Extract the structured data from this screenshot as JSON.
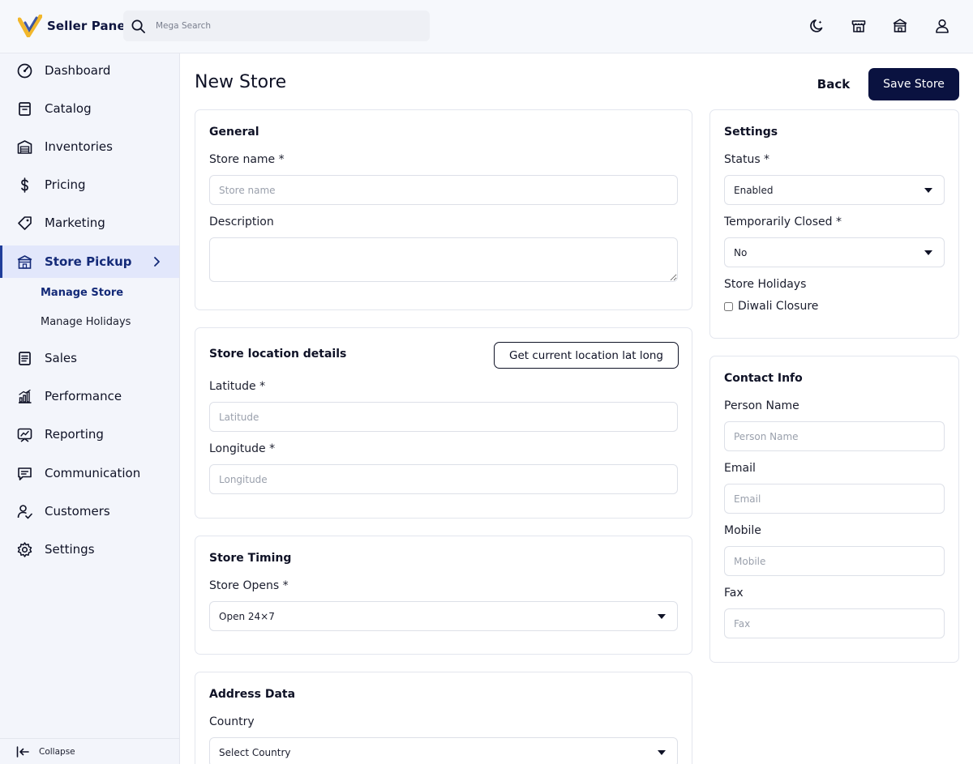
{
  "header": {
    "brand": "Seller Panel",
    "search_placeholder": "Mega Search",
    "icons": [
      "search-icon",
      "moon-icon",
      "storefront-icon",
      "store-building-icon",
      "user-icon"
    ]
  },
  "sidebar": {
    "items": [
      {
        "label": "Dashboard",
        "icon": "dashboard-gauge-icon"
      },
      {
        "label": "Catalog",
        "icon": "catalog-icon"
      },
      {
        "label": "Inventories",
        "icon": "warehouse-icon"
      },
      {
        "label": "Pricing",
        "icon": "dollar-icon"
      },
      {
        "label": "Marketing",
        "icon": "tag-icon"
      },
      {
        "label": "Store Pickup",
        "icon": "store-icon",
        "active": true
      },
      {
        "label": "Sales",
        "icon": "receipt-icon"
      },
      {
        "label": "Performance",
        "icon": "bar-chart-icon"
      },
      {
        "label": "Reporting",
        "icon": "report-icon"
      },
      {
        "label": "Communication",
        "icon": "chat-icon"
      },
      {
        "label": "Customers",
        "icon": "customers-icon"
      },
      {
        "label": "Settings",
        "icon": "gear-icon"
      }
    ],
    "subitems": [
      {
        "label": "Manage Store",
        "active": true
      },
      {
        "label": "Manage Holidays"
      }
    ],
    "collapse_label": "Collapse"
  },
  "page": {
    "title": "New Store",
    "back_label": "Back",
    "save_label": "Save Store"
  },
  "general": {
    "title": "General",
    "store_name_label": "Store name  *",
    "store_name_placeholder": "Store name",
    "description_label": "Description"
  },
  "location": {
    "title": "Store location details",
    "get_location_label": "Get current location lat long",
    "latitude_label": "Latitude  *",
    "latitude_placeholder": "Latitude",
    "longitude_label": "Longitude  *",
    "longitude_placeholder": "Longitude"
  },
  "timing": {
    "title": "Store Timing",
    "opens_label": "Store Opens  *",
    "opens_value": "Open 24×7"
  },
  "address": {
    "title": "Address Data",
    "country_label": "Country",
    "country_value": "Select Country"
  },
  "settings": {
    "title": "Settings",
    "status_label": "Status  *",
    "status_value": "Enabled",
    "temp_closed_label": "Temporarily Closed  *",
    "temp_closed_value": "No",
    "holidays_label": "Store Holidays",
    "holiday_option": "Diwali Closure"
  },
  "contact": {
    "title": "Contact Info",
    "person_label": "Person Name",
    "person_placeholder": "Person Name",
    "email_label": "Email",
    "email_placeholder": "Email",
    "mobile_label": "Mobile",
    "mobile_placeholder": "Mobile",
    "fax_label": "Fax",
    "fax_placeholder": "Fax"
  },
  "colors": {
    "primary": "#0a1240",
    "active_bg": "#e2e7fb",
    "logo_yellow": "#f2b72b",
    "logo_blue": "#1f3d9a"
  }
}
